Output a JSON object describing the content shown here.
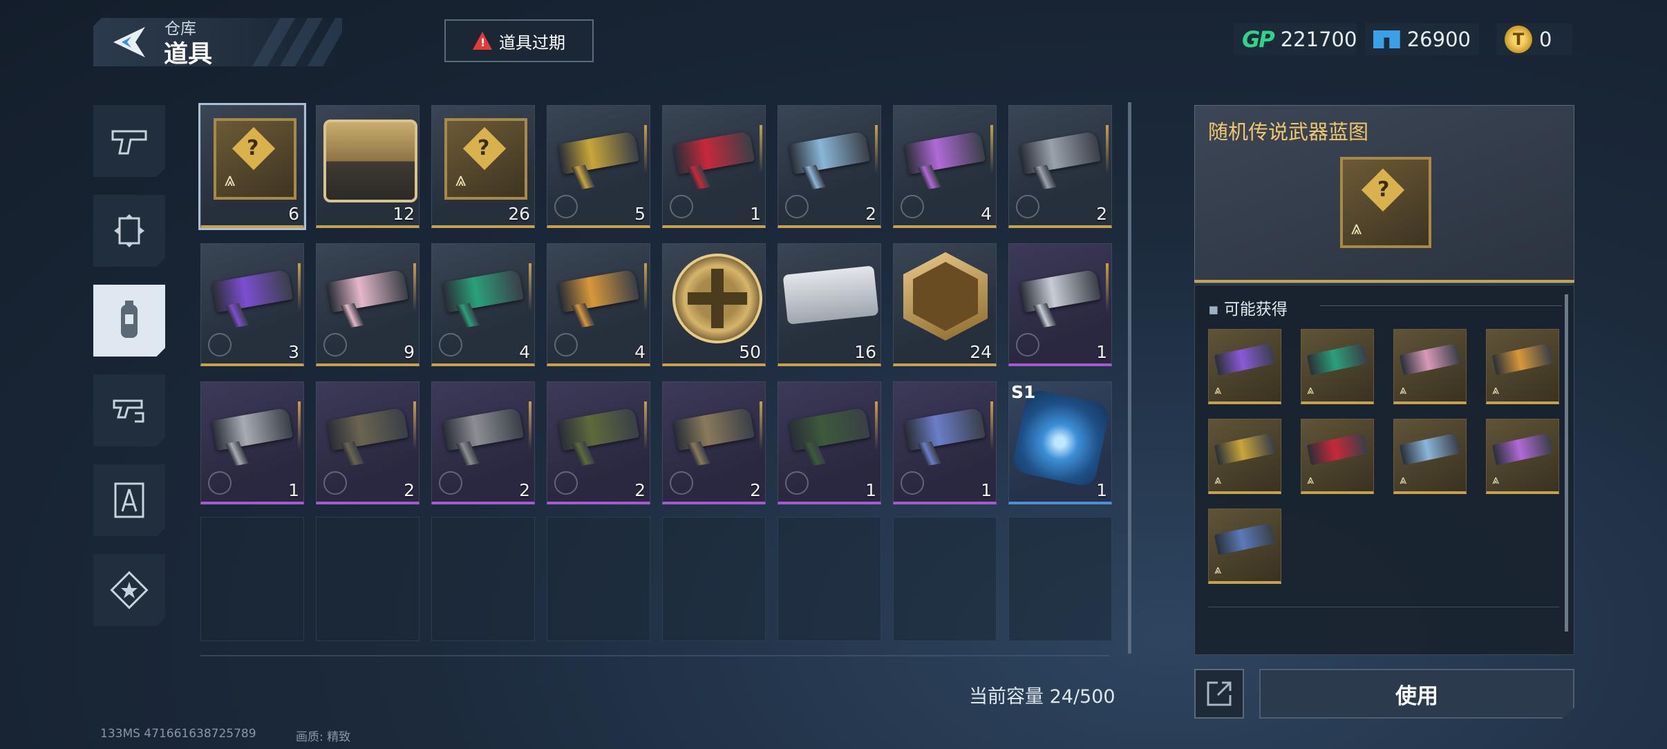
{
  "header": {
    "breadcrumb_parent": "仓库",
    "breadcrumb_title": "道具",
    "expire_button_label": "道具过期"
  },
  "currencies": {
    "gp_label": "GP",
    "gp_value": "221700",
    "ticket_value": "26900",
    "coin_value": "0"
  },
  "sidebar": {
    "tabs": [
      {
        "icon": "pistol-icon",
        "selected": false
      },
      {
        "icon": "scroll-frame-icon",
        "selected": false
      },
      {
        "icon": "canister-icon",
        "selected": true
      },
      {
        "icon": "gun-swap-icon",
        "selected": false
      },
      {
        "icon": "compass-blueprint-icon",
        "selected": false
      },
      {
        "icon": "star-badge-icon",
        "selected": false
      }
    ]
  },
  "inventory": {
    "rows": [
      [
        {
          "kind": "blueprint",
          "rarity": "gold",
          "count": "6",
          "selected": true
        },
        {
          "kind": "chest",
          "rarity": "gold",
          "count": "12"
        },
        {
          "kind": "blueprint",
          "rarity": "gold",
          "count": "26"
        },
        {
          "kind": "weapon",
          "rarity": "gold",
          "count": "5",
          "color": "#c9a63a"
        },
        {
          "kind": "weapon",
          "rarity": "gold",
          "count": "1",
          "color": "#c8283a"
        },
        {
          "kind": "weapon",
          "rarity": "gold",
          "count": "2",
          "color": "#8ab6d8"
        },
        {
          "kind": "weapon",
          "rarity": "gold",
          "count": "4",
          "color": "#b06ad6"
        },
        {
          "kind": "weapon",
          "rarity": "gold",
          "count": "2",
          "color": "#9aa2ab"
        }
      ],
      [
        {
          "kind": "weapon",
          "rarity": "gold",
          "count": "3",
          "color": "#7c4ed0"
        },
        {
          "kind": "weapon",
          "rarity": "gold",
          "count": "9",
          "color": "#e4b8c8"
        },
        {
          "kind": "weapon",
          "rarity": "gold",
          "count": "4",
          "color": "#2aa07a"
        },
        {
          "kind": "weapon",
          "rarity": "gold",
          "count": "4",
          "color": "#d8983a"
        },
        {
          "kind": "medal",
          "rarity": "gold",
          "count": "50"
        },
        {
          "kind": "cartridge",
          "rarity": "gold",
          "count": "16"
        },
        {
          "kind": "hexbadge",
          "rarity": "gold",
          "count": "24"
        },
        {
          "kind": "weapon",
          "rarity": "purple",
          "count": "1",
          "color": "#c8ccd4"
        }
      ],
      [
        {
          "kind": "weapon",
          "rarity": "purple",
          "count": "1",
          "color": "#a8acb2"
        },
        {
          "kind": "weapon",
          "rarity": "purple",
          "count": "2",
          "color": "#6a6450"
        },
        {
          "kind": "weapon",
          "rarity": "purple",
          "count": "2",
          "color": "#8c8e92"
        },
        {
          "kind": "weapon",
          "rarity": "purple",
          "count": "2",
          "color": "#5e6a3a"
        },
        {
          "kind": "weapon",
          "rarity": "purple",
          "count": "2",
          "color": "#8a7a5a"
        },
        {
          "kind": "weapon",
          "rarity": "purple",
          "count": "1",
          "color": "#3c5a3a"
        },
        {
          "kind": "weapon",
          "rarity": "purple",
          "count": "1",
          "color": "#6a7ec8"
        },
        {
          "kind": "cube",
          "rarity": "blue",
          "count": "1",
          "tag": "S1"
        }
      ]
    ],
    "empty_slots": 8
  },
  "capacity_text": "当前容量 24/500",
  "detail": {
    "title": "随机传说武器蓝图",
    "drops_header": "可能获得",
    "drops": [
      {
        "color": "#8a5ad6"
      },
      {
        "color": "#2aa07a"
      },
      {
        "color": "#d89ab8"
      },
      {
        "color": "#d8983a"
      },
      {
        "color": "#c9a63a"
      },
      {
        "color": "#c8283a"
      },
      {
        "color": "#8ab6d8"
      },
      {
        "color": "#b06ad6"
      },
      {
        "color": "#5a7ab8"
      }
    ],
    "use_button_label": "使用"
  },
  "footer": {
    "info": "133MS  471661638725789",
    "quality": "画质: 精致"
  },
  "colors": {
    "accent_gold": "#c6a24f",
    "rarity_purple": "#a55ad0",
    "rarity_blue": "#4d8fd6",
    "warning_red": "#e23b3b"
  }
}
